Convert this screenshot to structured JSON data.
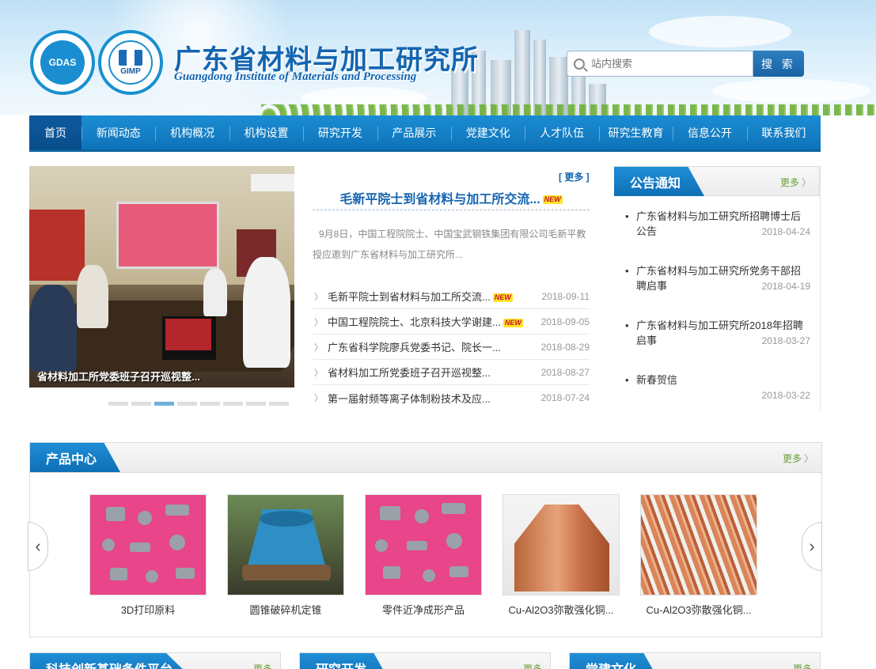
{
  "header": {
    "title": "广东省材料与加工研究所",
    "subtitle": "Guangdong Institute of Materials and Processing",
    "logo1_text": "GDAS",
    "logo2_text": "GIMP"
  },
  "search": {
    "placeholder": "站内搜索",
    "button": "搜 索"
  },
  "nav": [
    "首页",
    "新闻动态",
    "机构概况",
    "机构设置",
    "研究开发",
    "产品展示",
    "党建文化",
    "人才队伍",
    "研究生教育",
    "信息公开",
    "联系我们"
  ],
  "slide": {
    "caption": "省材料加工所党委班子召开巡视整..."
  },
  "news": {
    "more": "[ 更多 ]",
    "headline": "毛新平院士到省材料与加工所交流...",
    "badge": "NEW",
    "summary": "9月8日，中国工程院院士、中国宝武钢铁集团有限公司毛新平教授应邀到广东省材料与加工研究所...",
    "items": [
      {
        "title": "毛新平院士到省材料与加工所交流...",
        "date": "2018-09-11",
        "new": true
      },
      {
        "title": "中国工程院院士、北京科技大学谢建...",
        "date": "2018-09-05",
        "new": true
      },
      {
        "title": "广东省科学院廖兵党委书记、院长一...",
        "date": "2018-08-29",
        "new": false
      },
      {
        "title": "省材料加工所党委班子召开巡视整...",
        "date": "2018-08-27",
        "new": false
      },
      {
        "title": "第一届射频等离子体制粉技术及应...",
        "date": "2018-07-24",
        "new": false
      }
    ]
  },
  "notice": {
    "title": "公告通知",
    "more": "更多",
    "items": [
      {
        "title": "广东省材料与加工研究所招聘博士后公告",
        "date": "2018-04-24"
      },
      {
        "title": "广东省材料与加工研究所党务干部招聘启事",
        "date": "2018-04-19"
      },
      {
        "title": "广东省材料与加工研究所2018年招聘启事",
        "date": "2018-03-27"
      },
      {
        "title": "新春贺信",
        "date": "2018-03-22"
      }
    ]
  },
  "products": {
    "title": "产品中心",
    "more": "更多",
    "items": [
      {
        "name": "3D打印原料"
      },
      {
        "name": "圆锥破碎机定锥"
      },
      {
        "name": "零件近净成形产品"
      },
      {
        "name": "Cu-Al2O3弥散强化铜..."
      },
      {
        "name": "Cu-Al2O3弥散强化铜..."
      }
    ]
  },
  "bottom_panels": [
    {
      "title": "科技创新基础条件平台",
      "more": "更多"
    },
    {
      "title": "研究开发",
      "more": "更多"
    },
    {
      "title": "党建文化",
      "more": "更多"
    }
  ],
  "colors": {
    "primary": "#1565b0",
    "nav": "#1b8dd3",
    "more_green": "#6aa03a"
  }
}
